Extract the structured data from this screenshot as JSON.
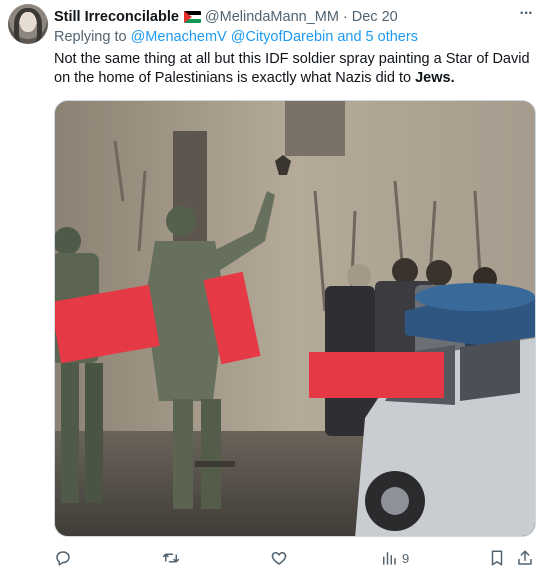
{
  "tweet": {
    "display_name": "Still Irreconcilable",
    "handle": "@MelindaMann_MM",
    "separator": "·",
    "date": "Dec 20",
    "more_label": "···",
    "replying": {
      "prefix": "Replying to",
      "mention1": "@MenachemV",
      "mention2": "@CityofDarebin",
      "others": "and 5 others"
    },
    "text_line1": "Not the same thing at all but this IDF soldier spray painting a Star of David",
    "text_line2_plain": "on the home of Palestinians is exactly what Nazis did to",
    "text_line2_bold": "Jews."
  },
  "actions": {
    "views_count": "9"
  },
  "icons": {
    "reply": "reply-icon",
    "retweet": "retweet-icon",
    "like": "like-icon",
    "views": "views-icon",
    "bookmark": "bookmark-icon",
    "share": "share-icon"
  },
  "colors": {
    "link": "#1d9bf0",
    "secondary_text": "#536471",
    "redaction": "#e63946"
  }
}
